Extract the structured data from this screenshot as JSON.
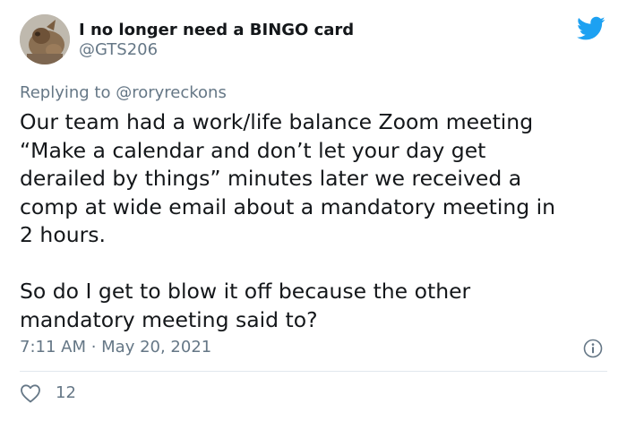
{
  "author": {
    "display_name": "I no longer need a BINGO card",
    "handle": "@GTS206",
    "avatar_icon": "gargoyle-statue-avatar"
  },
  "brand": {
    "icon": "twitter-bird-icon",
    "color": "#1da1f2"
  },
  "reply": {
    "prefix": "Replying to",
    "mention": "@roryreckons"
  },
  "tweet": {
    "text": "Our team had a work/life balance Zoom meeting\n“Make a calendar and don’t let your day get\nderailed by things” minutes later we received a\ncomp at wide email about a mandatory meeting in\n2 hours.\n\nSo do I get to blow it off because the other\nmandatory meeting said to?",
    "timestamp": "7:11 AM · May 20, 2021"
  },
  "actions": {
    "like_icon": "heart-icon",
    "like_count": "12",
    "info_icon": "info-icon"
  },
  "colors": {
    "text_primary": "#14171a",
    "text_secondary": "#657786",
    "divider": "#e1e8ed"
  }
}
